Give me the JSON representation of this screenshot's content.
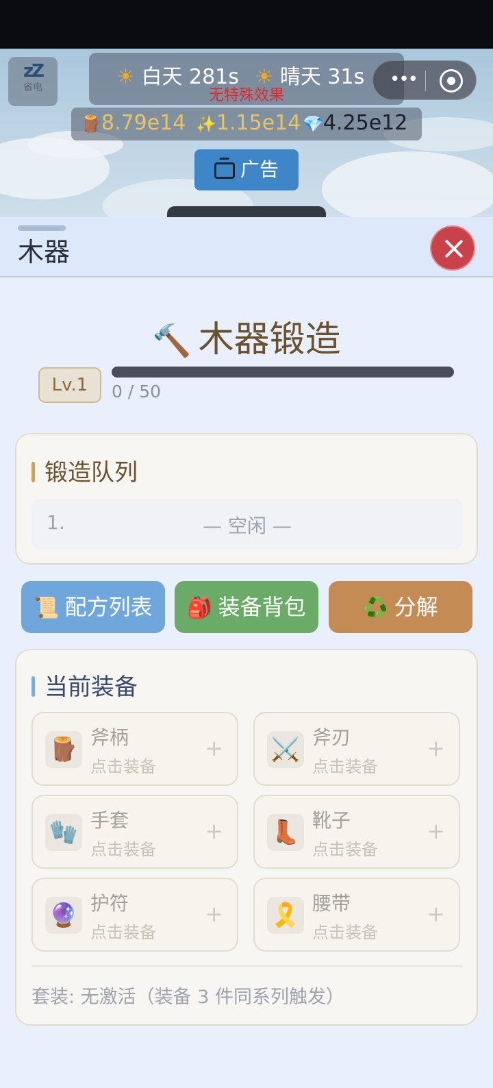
{
  "power": {
    "icon": "sleep-icon",
    "label": "省电"
  },
  "weather": {
    "period": "白天 281s",
    "condition": "晴天 31s",
    "effect": "无特殊效果"
  },
  "resources": {
    "wood": "8.79e14",
    "sparkle": "1.15e14",
    "gem": "4.25e12"
  },
  "ad_button": {
    "label": "广告"
  },
  "sheet": {
    "title": "木器"
  },
  "forge": {
    "title": "木器锻造",
    "level": "Lv.1",
    "xp_text": "0 / 50",
    "xp_fraction": 0
  },
  "queue": {
    "title": "锻造队列",
    "slot_index": "1.",
    "slot_status": "— 空闲 —"
  },
  "actions": {
    "recipe": "配方列表",
    "bag": "装备背包",
    "decompose": "分解"
  },
  "equipment": {
    "title": "当前装备",
    "slots": [
      {
        "name": "斧柄",
        "hint": "点击装备",
        "icon": "log-icon"
      },
      {
        "name": "斧刃",
        "hint": "点击装备",
        "icon": "crossed-swords-icon"
      },
      {
        "name": "手套",
        "hint": "点击装备",
        "icon": "gloves-icon"
      },
      {
        "name": "靴子",
        "hint": "点击装备",
        "icon": "boot-icon"
      },
      {
        "name": "护符",
        "hint": "点击装备",
        "icon": "crystal-ball-icon"
      },
      {
        "name": "腰带",
        "hint": "点击装备",
        "icon": "ribbon-icon"
      }
    ],
    "set_text": "套装: 无激活（装备 3 件同系列触发）"
  },
  "colors": {
    "accent_blue": "#6fa6dc",
    "accent_green": "#6bab68",
    "accent_orange": "#c48b55",
    "close_red": "#c9424a"
  }
}
